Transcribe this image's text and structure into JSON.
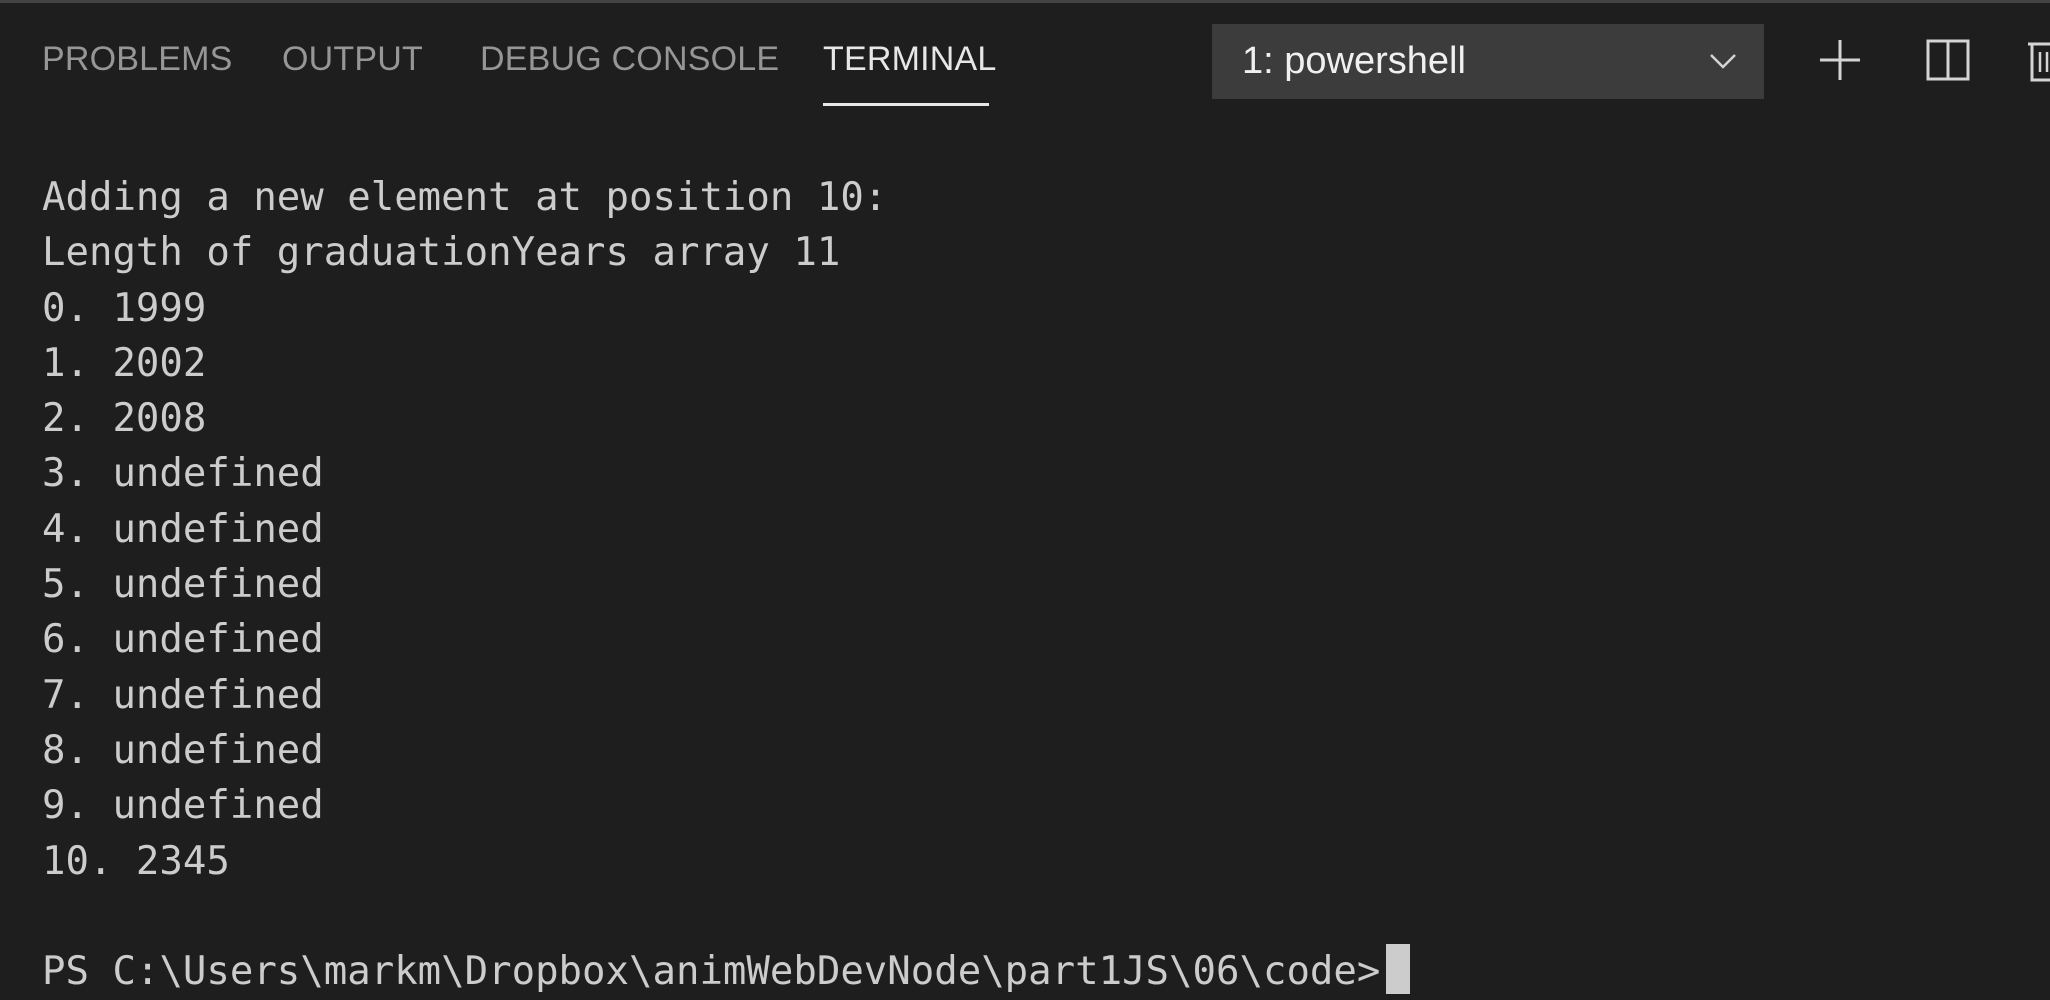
{
  "panel": {
    "tabs": [
      {
        "label": "PROBLEMS"
      },
      {
        "label": "OUTPUT"
      },
      {
        "label": "DEBUG CONSOLE"
      },
      {
        "label": "TERMINAL",
        "active": true
      }
    ],
    "terminal_selector": {
      "selected": "1: powershell"
    },
    "actions": {
      "new_terminal_icon": "plus-icon",
      "split_terminal_icon": "split-icon",
      "kill_terminal_icon": "trash-icon"
    }
  },
  "terminal": {
    "lines": [
      "Adding a new element at position 10:",
      "Length of graduationYears array 11",
      "0. 1999",
      "1. 2002",
      "2. 2008",
      "3. undefined",
      "4. undefined",
      "5. undefined",
      "6. undefined",
      "7. undefined",
      "8. undefined",
      "9. undefined",
      "10. 2345"
    ],
    "prompt": "PS C:\\Users\\markm\\Dropbox\\animWebDevNode\\part1JS\\06\\code>"
  },
  "colors": {
    "background": "#1e1e1e",
    "text": "#cccccc",
    "active_tab": "#e7e7e7",
    "inactive_tab": "#969696",
    "dropdown_bg": "#3c3c3c"
  }
}
